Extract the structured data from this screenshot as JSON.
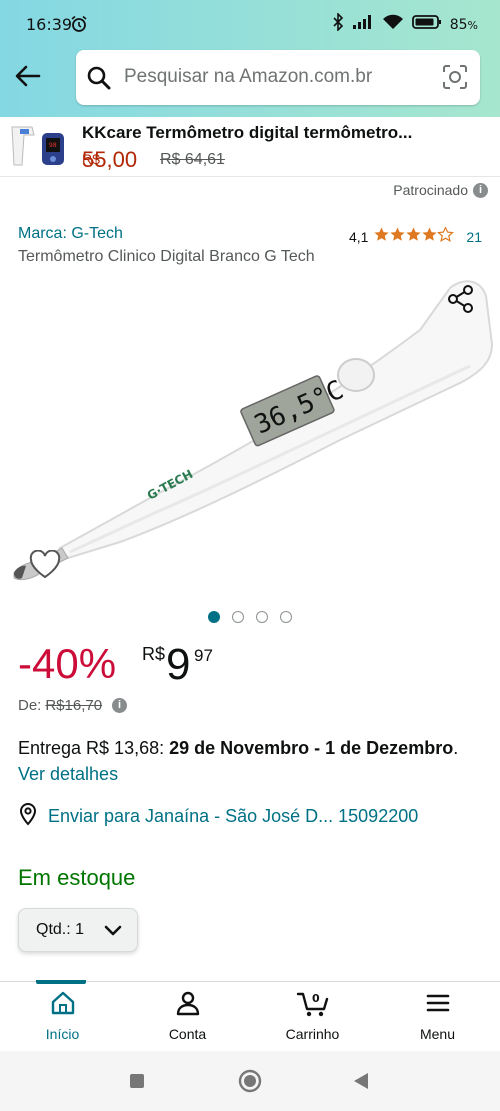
{
  "status_bar": {
    "time": "16:39",
    "battery": "85",
    "battery_unit": "%"
  },
  "search": {
    "placeholder": "Pesquisar na Amazon.com.br"
  },
  "sponsored_ad": {
    "title": "KKcare Termômetro digital termômetro...",
    "currency": "R$",
    "price": "55,00",
    "old_price": "R$ 64,61"
  },
  "sponsored_label": "Patrocinado",
  "product": {
    "brand": "Marca: G-Tech",
    "rating": "4,1",
    "stars": 4.1,
    "review_count": "21",
    "title": "Termômetro Clinico Digital Branco G Tech",
    "image_display_text": "36,5°C",
    "image_logo_text": "G·TECH",
    "image_count": 4,
    "active_image": 1
  },
  "pricing": {
    "discount": "-40%",
    "currency": "R$",
    "price_int": "9",
    "price_dec": "97",
    "list_label": "De:",
    "list_price": "R$16,70"
  },
  "delivery": {
    "prefix": "Entrega R$ 13,68: ",
    "dates": "29 de Novembro - 1 de Dezembro",
    "suffix": ". ",
    "details_link": "Ver detalhes"
  },
  "ship_to": "Enviar para Janaína - São José D... 15092200",
  "stock": "Em estoque",
  "quantity": {
    "label": "Qtd.: 1"
  },
  "bottom_nav": {
    "items": [
      {
        "label": "Início",
        "icon": "home-icon",
        "active": true
      },
      {
        "label": "Conta",
        "icon": "account-icon",
        "active": false
      },
      {
        "label": "Carrinho",
        "icon": "cart-icon",
        "badge": "0",
        "active": false
      },
      {
        "label": "Menu",
        "icon": "menu-icon",
        "active": false
      }
    ]
  },
  "colors": {
    "link": "#007185",
    "discount": "#cc0c39",
    "price_red": "#b12704",
    "stock_green": "#007600",
    "star": "#de7921"
  }
}
